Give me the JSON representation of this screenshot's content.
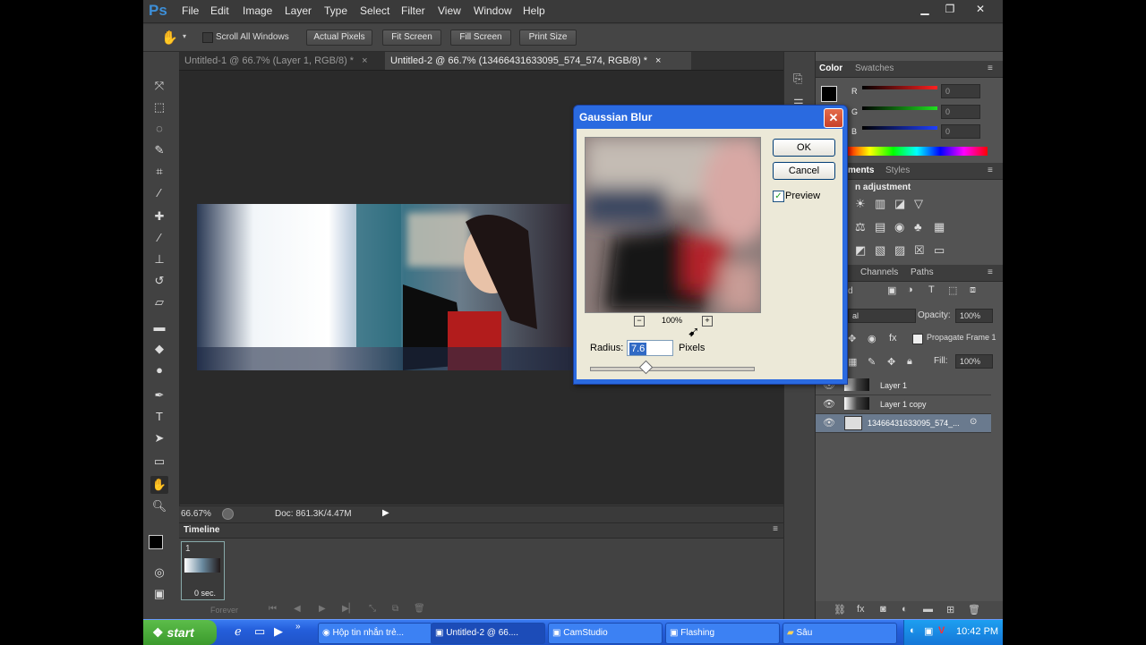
{
  "app": {
    "logo": "Ps"
  },
  "menu": [
    "File",
    "Edit",
    "Image",
    "Layer",
    "Type",
    "Select",
    "Filter",
    "View",
    "Window",
    "Help"
  ],
  "options": {
    "scroll_all": "Scroll All Windows",
    "actual_pixels": "Actual Pixels",
    "fit_screen": "Fit Screen",
    "fill_screen": "Fill Screen",
    "print_size": "Print Size"
  },
  "tabs": [
    {
      "label": "Untitled-1 @ 66.7% (Layer 1, RGB/8) *",
      "close": "×"
    },
    {
      "label": "Untitled-2 @ 66.7% (13466431633095_574_574, RGB/8) *",
      "close": "×"
    }
  ],
  "status": {
    "zoom": "66.67%",
    "doc": "Doc: 861.3K/4.47M"
  },
  "timeline": {
    "title": "Timeline",
    "frame_num": "1",
    "frame_time": "0 sec.",
    "loop": "Forever"
  },
  "color_panel": {
    "tabs": [
      "Color",
      "Swatches"
    ],
    "channels": [
      {
        "label": "R",
        "value": "0",
        "color": "#e02020"
      },
      {
        "label": "G",
        "value": "0",
        "color": "#20c020"
      },
      {
        "label": "B",
        "value": "0",
        "color": "#2040e0"
      }
    ]
  },
  "adjustments_panel": {
    "tabs": [
      "ments",
      "Styles"
    ],
    "heading": "n adjustment"
  },
  "layers_panel": {
    "tabs": [
      "Channels",
      "Paths"
    ],
    "kind": "d",
    "blend": "al",
    "opacity_label": "Opacity:",
    "opacity": "100%",
    "fill_label": "Fill:",
    "fill": "100%",
    "propagate": "Propagate Frame 1",
    "layers": [
      "Layer 1",
      "Layer 1 copy",
      "13466431633095_574_..."
    ]
  },
  "dialog": {
    "title": "Gaussian Blur",
    "close": "✕",
    "ok": "OK",
    "cancel": "Cancel",
    "preview": "Preview",
    "zoom": "100%",
    "radius_label": "Radius:",
    "radius_value": "7.6",
    "unit": "Pixels",
    "slider_level": 0.34
  },
  "taskbar": {
    "start": "start",
    "tasks": [
      "Hộp tin nhắn trẻ...",
      "Untitled-2 @ 66....",
      "CamStudio",
      "Flashing",
      "Sâu"
    ],
    "time": "10:42 PM"
  }
}
